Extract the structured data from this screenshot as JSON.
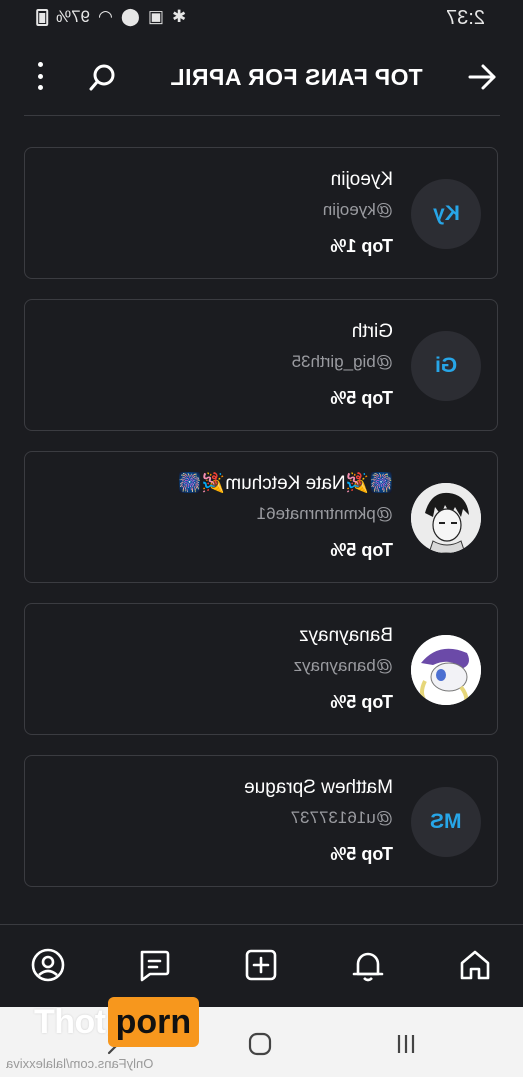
{
  "status_bar": {
    "time": "2:37",
    "battery": "97%"
  },
  "header": {
    "title": "TOP FANS FOR APRIL"
  },
  "fans": [
    {
      "initials": "Ky",
      "name": "Kyeojin",
      "handle": "@kyeojin",
      "rank": "Top 1%"
    },
    {
      "initials": "Gi",
      "name": "Girth",
      "handle": "@big_girth35",
      "rank": "Top 5%"
    },
    {
      "initials": "",
      "name": "🎆🎉Nate Ketchum🎉🎆",
      "handle": "@pkmntrnrnate61",
      "rank": "Top 5%"
    },
    {
      "initials": "",
      "name": "Banaynayz",
      "handle": "@banaynayz",
      "rank": "Top 5%"
    },
    {
      "initials": "MS",
      "name": "Matthew Sprague",
      "handle": "@u16137737",
      "rank": "Top 5%"
    }
  ],
  "watermark": {
    "left": "Thot",
    "right": "porn",
    "url": "OnlyFans.com/lalalexxiva"
  },
  "colors": {
    "background": "#1b1c20",
    "accent": "#27a6e8",
    "card_border": "#3b3c41",
    "watermark_orange": "#f7971d"
  }
}
